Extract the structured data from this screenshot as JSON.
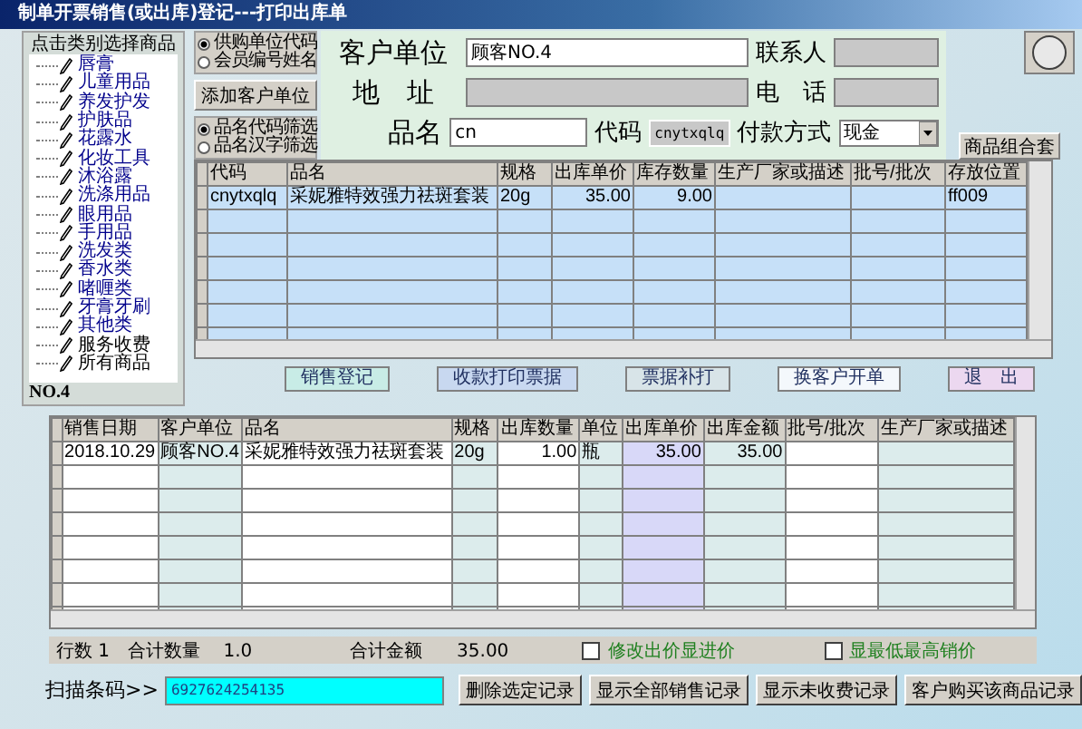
{
  "window": {
    "title": "制单开票销售(或出库)登记---打印出库单"
  },
  "category_panel": {
    "header": "点击类别选择商品",
    "items": [
      {
        "label": "唇膏"
      },
      {
        "label": "儿童用品"
      },
      {
        "label": "养发护发"
      },
      {
        "label": "护肤品"
      },
      {
        "label": "花露水"
      },
      {
        "label": "化妆工具"
      },
      {
        "label": "沐浴露"
      },
      {
        "label": "洗涤用品"
      },
      {
        "label": "眼用品"
      },
      {
        "label": "手用品"
      },
      {
        "label": "洗发类"
      },
      {
        "label": "香水类"
      },
      {
        "label": "啫喱类"
      },
      {
        "label": "牙膏牙刷"
      },
      {
        "label": "其他类"
      },
      {
        "label": "服务收费"
      },
      {
        "label": "所有商品"
      }
    ],
    "footer": "NO.4"
  },
  "customer_search_mode": [
    {
      "label": "供购单位代码",
      "selected": true
    },
    {
      "label": "会员编号姓名",
      "selected": false
    }
  ],
  "add_customer_button": "添加客户单位",
  "product_filter_mode": [
    {
      "label": "品名代码筛选",
      "selected": true
    },
    {
      "label": "品名汉字筛选",
      "selected": false
    }
  ],
  "customer_form": {
    "customer_label": "客户单位",
    "customer_value": "顾客NO.4",
    "contact_label": "联系人",
    "address_label": "地　址",
    "phone_label": "电　话",
    "product_label": "品名",
    "product_value": "cn",
    "code_label": "代码",
    "code_value": "cnytxqlq",
    "payment_label": "付款方式",
    "payment_value": "现金"
  },
  "combo_button": "商品组合套",
  "product_grid": {
    "columns": [
      "代码",
      "品名",
      "规格",
      "出库单价",
      "库存数量",
      "生产厂家或描述",
      "批号/批次",
      "存放位置"
    ],
    "rows": [
      {
        "cells": [
          "cnytxqlq",
          "采妮雅特效强力祛斑套装",
          "20g",
          "35.00",
          "9.00",
          "",
          "",
          "ff009"
        ],
        "selected": true
      }
    ]
  },
  "action_buttons": [
    {
      "label": "销售登记",
      "color": "#c8ece6"
    },
    {
      "label": "收款打印票据",
      "color": "#c8d8f0"
    },
    {
      "label": "票据补打",
      "color": "#d8e4e8"
    },
    {
      "label": "换客户开单",
      "color": "#f4f8fc"
    },
    {
      "label": "退　出",
      "color": "#ecd8f0"
    }
  ],
  "sales_grid": {
    "columns": [
      "销售日期",
      "客户单位",
      "品名",
      "规格",
      "出库数量",
      "单位",
      "出库单价",
      "出库金额",
      "批号/批次",
      "生产厂家或描述"
    ],
    "rows": [
      [
        "2018.10.29",
        "顾客NO.4",
        "采妮雅特效强力祛斑套装",
        "20g",
        "1.00",
        "瓶",
        "35.00",
        "35.00",
        "",
        ""
      ]
    ]
  },
  "totals": {
    "row_count_label": "行数",
    "row_count": "1",
    "qty_label": "合计数量",
    "qty": "1.0",
    "amount_label": "合计金额",
    "amount": "35.00"
  },
  "options": [
    {
      "label": "修改出价显进价",
      "checked": false
    },
    {
      "label": "显最低最高销价",
      "checked": false
    }
  ],
  "scan": {
    "label": "扫描条码>>",
    "value": "6927624254135"
  },
  "bottom_buttons": [
    "删除选定记录",
    "显示全部销售记录",
    "显示未收费记录",
    "客户购买该商品记录"
  ]
}
